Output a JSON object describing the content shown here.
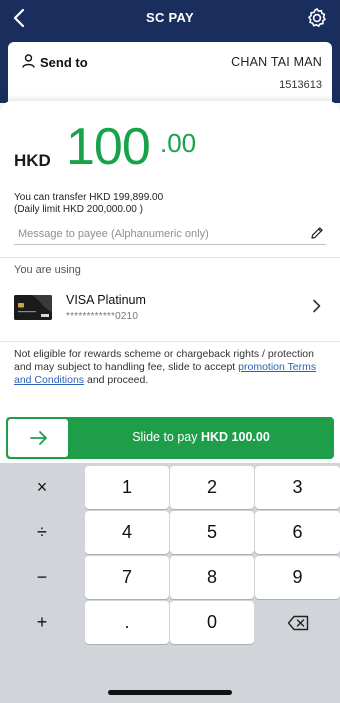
{
  "header": {
    "title": "SC PAY"
  },
  "send_card": {
    "label": "Send to",
    "payee_name": "CHAN TAI MAN",
    "account": "1513613"
  },
  "amount": {
    "currency": "HKD",
    "integer": "100",
    "decimal": ".00"
  },
  "limits": {
    "transfer": "You can transfer HKD 199,899.00",
    "daily": "(Daily limit HKD 200,000.00 )"
  },
  "message": {
    "placeholder": "Message to payee (Alphanumeric only)",
    "value": ""
  },
  "payment_source": {
    "label": "You are using",
    "card_name": "VISA Platinum",
    "card_number": "************0210"
  },
  "notice": {
    "text_before": "Not eligible for rewards scheme or chargeback rights / protection and may subject to handling fee, slide to accept ",
    "link": "promotion Terms and Conditions",
    "text_after": " and proceed."
  },
  "slider": {
    "prefix": "Slide to pay",
    "amount": "HKD 100.00"
  },
  "keypad": {
    "keys": [
      {
        "label": "×",
        "kind": "op"
      },
      {
        "label": "1",
        "kind": "num"
      },
      {
        "label": "2",
        "kind": "num"
      },
      {
        "label": "3",
        "kind": "num"
      },
      {
        "label": "÷",
        "kind": "op"
      },
      {
        "label": "4",
        "kind": "num"
      },
      {
        "label": "5",
        "kind": "num"
      },
      {
        "label": "6",
        "kind": "num"
      },
      {
        "label": "−",
        "kind": "op"
      },
      {
        "label": "7",
        "kind": "num"
      },
      {
        "label": "8",
        "kind": "num"
      },
      {
        "label": "9",
        "kind": "num"
      },
      {
        "label": "+",
        "kind": "op"
      },
      {
        "label": ".",
        "kind": "num"
      },
      {
        "label": "0",
        "kind": "num"
      },
      {
        "label": "",
        "kind": "backspace"
      }
    ]
  },
  "colors": {
    "header": "#1a2e5e",
    "accent_green": "#17a34a",
    "slider_green": "#1f9e4a",
    "link": "#2a62b8",
    "keypad_bg": "#d1d4d9"
  }
}
